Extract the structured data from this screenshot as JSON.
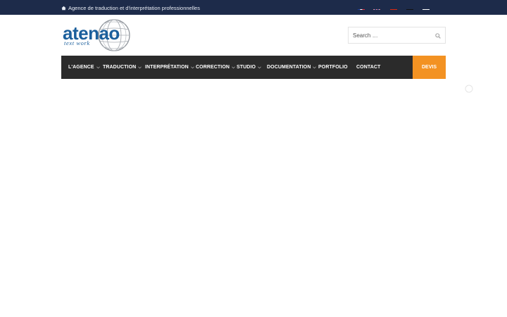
{
  "topbar": {
    "tagline": "Agence de traduction et d'interprétation professionnelles",
    "languages": [
      {
        "icon": "flag-france-icon"
      },
      {
        "icon": "flag-uk-icon"
      },
      {
        "icon": "flag-china-icon"
      },
      {
        "icon": "flag-germany-icon"
      },
      {
        "icon": "flag-japan-icon"
      },
      {
        "icon": "flag-saudi-icon"
      }
    ]
  },
  "logo": {
    "wordmark": "atenao",
    "subtitle": "text work"
  },
  "search": {
    "placeholder": "Search …",
    "icon": "search-icon"
  },
  "nav": {
    "items": [
      {
        "label": "L'AGENCE",
        "has_submenu": true
      },
      {
        "label": "TRADUCTION",
        "has_submenu": true
      },
      {
        "label": "INTERPRÉTATION",
        "has_submenu": true
      },
      {
        "label": "CORRECTION",
        "has_submenu": true
      },
      {
        "label": "STUDIO",
        "has_submenu": true
      },
      {
        "label": "DOCUMENTATION",
        "has_submenu": true
      },
      {
        "label": "PORTFOLIO",
        "has_submenu": false
      },
      {
        "label": "CONTACT",
        "has_submenu": false
      }
    ],
    "cta_label": "DEVIS"
  },
  "colors": {
    "topbar": "#1d2b4a",
    "nav": "#2b2b2b",
    "cta": "#f39222",
    "brand": "#1b5f9c"
  }
}
